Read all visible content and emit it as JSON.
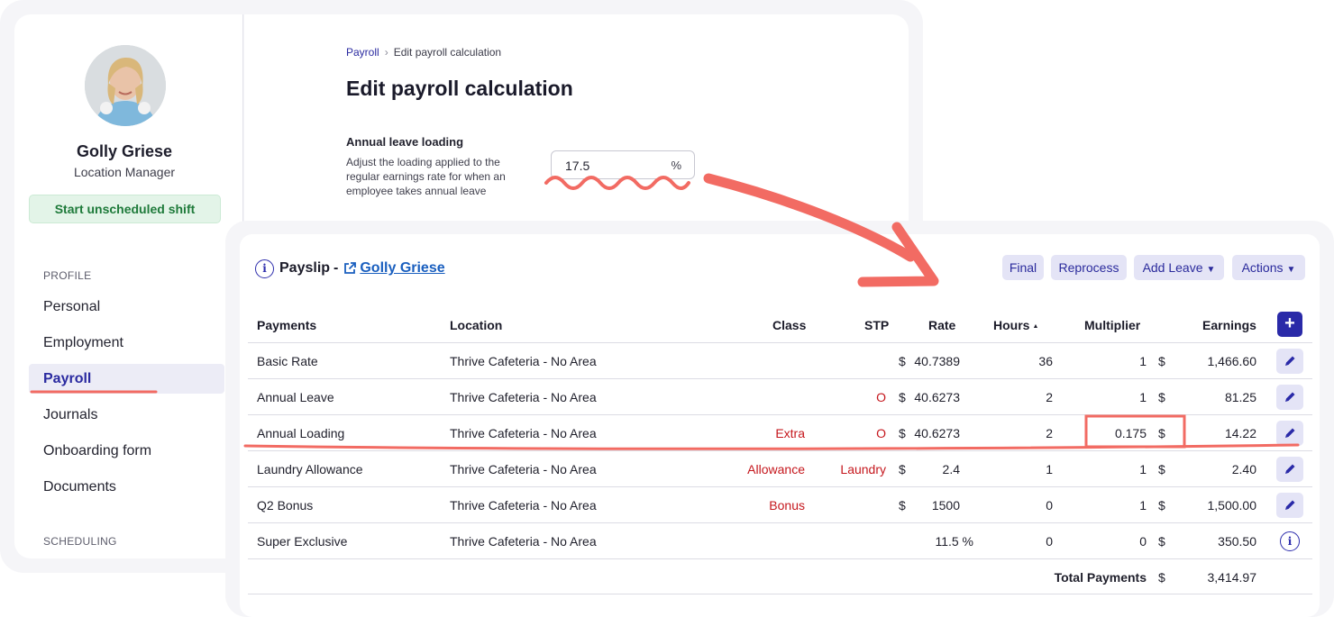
{
  "profile": {
    "name": "Golly Griese",
    "role": "Location Manager",
    "start_shift_label": "Start unscheduled shift",
    "sections": {
      "profile_heading": "PROFILE",
      "scheduling_heading": "SCHEDULING"
    },
    "nav_items": [
      {
        "label": "Personal"
      },
      {
        "label": "Employment"
      },
      {
        "label": "Payroll",
        "active": true
      },
      {
        "label": "Journals"
      },
      {
        "label": "Onboarding form"
      },
      {
        "label": "Documents"
      }
    ]
  },
  "edit_form": {
    "breadcrumb": [
      "Payroll",
      "Edit payroll calculation"
    ],
    "title": "Edit payroll calculation",
    "field_label": "Annual leave loading",
    "field_help": "Adjust the loading applied to the regular earnings rate for when an employee takes annual leave",
    "field_value": "17.5",
    "field_unit": "%"
  },
  "payslip": {
    "title": "Payslip",
    "separator": "-",
    "employee_link": "Golly Griese",
    "buttons": {
      "final": "Final",
      "reprocess": "Reprocess",
      "add_leave": "Add Leave",
      "actions": "Actions"
    },
    "columns": {
      "payments": "Payments",
      "location": "Location",
      "class": "Class",
      "stp": "STP",
      "rate": "Rate",
      "hours": "Hours",
      "hours_sort": "▲",
      "multiplier": "Multiplier",
      "earnings": "Earnings"
    },
    "rows": [
      {
        "payment": "Basic Rate",
        "location": "Thrive Cafeteria - No Area",
        "class": "",
        "stp": "",
        "rate_cur": "$",
        "rate": "40.7389",
        "hours": "36",
        "multiplier": "1",
        "earn_cur": "$",
        "earnings": "1,466.60"
      },
      {
        "payment": "Annual Leave",
        "location": "Thrive Cafeteria - No Area",
        "class": "",
        "stp": "O",
        "rate_cur": "$",
        "rate": "40.6273",
        "hours": "2",
        "multiplier": "1",
        "earn_cur": "$",
        "earnings": "81.25"
      },
      {
        "payment": "Annual Loading",
        "location": "Thrive Cafeteria - No Area",
        "class": "Extra",
        "stp": "O",
        "rate_cur": "$",
        "rate": "40.6273",
        "hours": "2",
        "multiplier": "0.175",
        "earn_cur": "$",
        "earnings": "14.22"
      },
      {
        "payment": "Laundry Allowance",
        "location": "Thrive Cafeteria - No Area",
        "class": "Allowance",
        "stp": "Laundry",
        "rate_cur": "$",
        "rate": "2.4",
        "hours": "1",
        "multiplier": "1",
        "earn_cur": "$",
        "earnings": "2.40"
      },
      {
        "payment": "Q2 Bonus",
        "location": "Thrive Cafeteria - No Area",
        "class": "Bonus",
        "stp": "",
        "rate_cur": "$",
        "rate": "1500",
        "hours": "0",
        "multiplier": "1",
        "earn_cur": "$",
        "earnings": "1,500.00"
      },
      {
        "payment": "Super Exclusive",
        "location": "Thrive Cafeteria - No Area",
        "class": "",
        "stp": "",
        "rate_cur": "",
        "rate": "11.5 %",
        "hours": "0",
        "multiplier": "0",
        "earn_cur": "$",
        "earnings": "350.50"
      }
    ],
    "total": {
      "label": "Total Payments",
      "currency": "$",
      "value": "3,414.97"
    }
  },
  "colors": {
    "accent": "#2a2aa8",
    "link": "#1a5fbf",
    "class_red": "#c5171d",
    "annotation": "#f26b63",
    "shift_green": "#1e7a3a"
  }
}
